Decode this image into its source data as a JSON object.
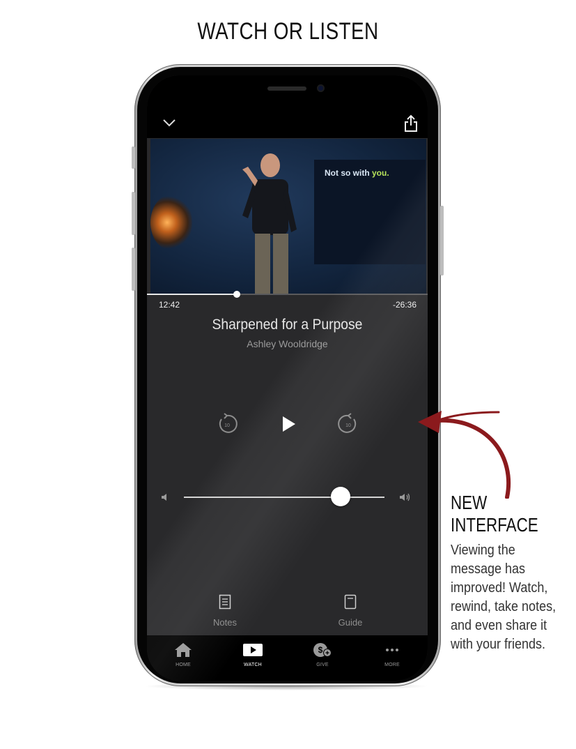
{
  "page": {
    "heading": "WATCH OR LISTEN"
  },
  "player": {
    "progress_fraction": 0.32,
    "time_elapsed": "12:42",
    "time_remaining": "-26:36",
    "title": "Sharpened for a Purpose",
    "speaker": "Ashley Wooldridge",
    "video_caption_prefix": "Not so with ",
    "video_caption_highlight": "you.",
    "rewind_seconds": "10",
    "forward_seconds": "10",
    "volume_fraction": 0.78
  },
  "bottom_actions": [
    {
      "label": "Notes",
      "icon": "notes-icon"
    },
    {
      "label": "Guide",
      "icon": "guide-icon"
    }
  ],
  "tabbar": {
    "items": [
      {
        "label": "HOME",
        "icon": "home-icon"
      },
      {
        "label": "WATCH",
        "icon": "watch-icon",
        "active": true
      },
      {
        "label": "GIVE",
        "icon": "give-icon"
      },
      {
        "label": "MORE",
        "icon": "more-icon"
      }
    ]
  },
  "callout": {
    "title_line1": "NEW",
    "title_line2": "INTERFACE",
    "body": "Viewing the message has improved! Watch, rewind, take notes, and even share it with your friends."
  },
  "colors": {
    "accent_arrow": "#8b1a1d",
    "screen_bg": "#29292b",
    "tabbar_bg": "#000000"
  }
}
